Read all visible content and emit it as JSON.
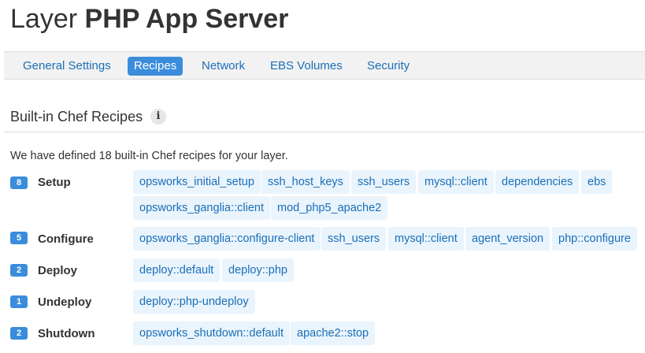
{
  "header": {
    "title_light": "Layer",
    "title_bold": "PHP App Server"
  },
  "tabs": [
    {
      "label": "General Settings",
      "active": false
    },
    {
      "label": "Recipes",
      "active": true
    },
    {
      "label": "Network",
      "active": false
    },
    {
      "label": "EBS Volumes",
      "active": false
    },
    {
      "label": "Security",
      "active": false
    }
  ],
  "section": {
    "title": "Built-in Chef Recipes",
    "info_icon": "info-icon",
    "info_glyph": "i",
    "description": "We have defined 18 built-in Chef recipes for your layer."
  },
  "stages": [
    {
      "count": "8",
      "label": "Setup",
      "recipes": [
        "opsworks_initial_setup",
        "ssh_host_keys",
        "ssh_users",
        "mysql::client",
        "dependencies",
        "ebs",
        "opsworks_ganglia::client",
        "mod_php5_apache2"
      ]
    },
    {
      "count": "5",
      "label": "Configure",
      "recipes": [
        "opsworks_ganglia::configure-client",
        "ssh_users",
        "mysql::client",
        "agent_version",
        "php::configure"
      ]
    },
    {
      "count": "2",
      "label": "Deploy",
      "recipes": [
        "deploy::default",
        "deploy::php"
      ]
    },
    {
      "count": "1",
      "label": "Undeploy",
      "recipes": [
        "deploy::php-undeploy"
      ]
    },
    {
      "count": "2",
      "label": "Shutdown",
      "recipes": [
        "opsworks_shutdown::default",
        "apache2::stop"
      ]
    }
  ],
  "colors": {
    "accent": "#3b8ddb",
    "link": "#1a6fb8",
    "chip_bg": "#eaf4fc",
    "text": "#333333"
  }
}
